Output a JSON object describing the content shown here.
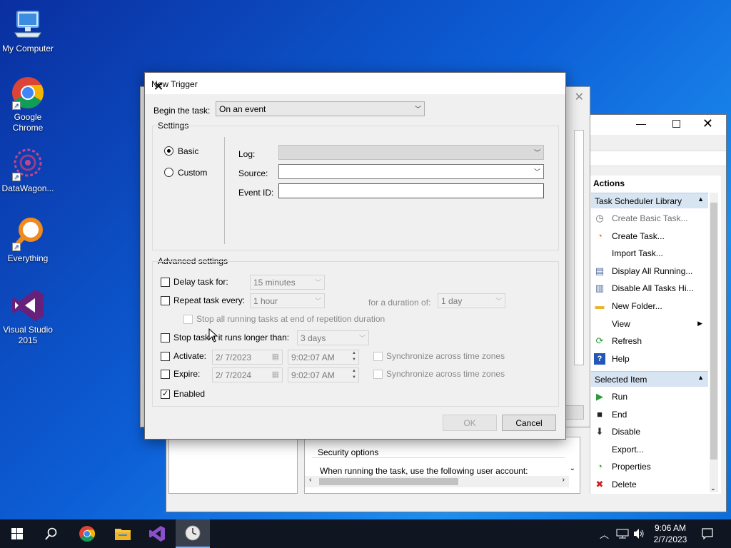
{
  "desktop": {
    "icons": [
      {
        "label": "My Computer"
      },
      {
        "label": "Google Chrome"
      },
      {
        "label": "DataWagon..."
      },
      {
        "label": "Everything"
      },
      {
        "label": "Visual Studio 2015"
      }
    ]
  },
  "task_scheduler": {
    "actions_title": "Actions",
    "library_section": "Task Scheduler Library",
    "library_items": [
      {
        "label": "Create Basic Task...",
        "icon": "create-basic-task-icon"
      },
      {
        "label": "Create Task...",
        "icon": "create-task-icon"
      },
      {
        "label": "Import Task...",
        "icon": ""
      },
      {
        "label": "Display All Running...",
        "icon": "display-running-icon"
      },
      {
        "label": "Disable All Tasks Hi...",
        "icon": "disable-history-icon"
      },
      {
        "label": "New Folder...",
        "icon": "folder-icon"
      },
      {
        "label": "View",
        "icon": ""
      },
      {
        "label": "Refresh",
        "icon": "refresh-icon"
      },
      {
        "label": "Help",
        "icon": "help-icon"
      }
    ],
    "selected_section": "Selected Item",
    "selected_items": [
      {
        "label": "Run",
        "icon": "run-icon"
      },
      {
        "label": "End",
        "icon": "end-icon"
      },
      {
        "label": "Disable",
        "icon": "disable-icon"
      },
      {
        "label": "Export...",
        "icon": ""
      },
      {
        "label": "Properties",
        "icon": "properties-icon"
      },
      {
        "label": "Delete",
        "icon": "delete-icon"
      }
    ],
    "security_options": "Security options",
    "security_text": "When running the task, use the following user account:"
  },
  "dialog": {
    "title": "New Trigger",
    "begin_label": "Begin the task:",
    "begin_value": "On an event",
    "settings_label": "Settings",
    "basic_label": "Basic",
    "custom_label": "Custom",
    "log_label": "Log:",
    "source_label": "Source:",
    "event_id_label": "Event ID:",
    "log_value": "",
    "source_value": "",
    "event_id_value": "",
    "advanced_label": "Advanced settings",
    "delay_label": "Delay task for:",
    "delay_value": "15 minutes",
    "repeat_label": "Repeat task every:",
    "repeat_value": "1 hour",
    "duration_label": "for a duration of:",
    "duration_value": "1 day",
    "stop_running_label": "Stop all running tasks at end of repetition duration",
    "stop_longer_label": "Stop task if it runs longer than:",
    "stop_longer_value": "3 days",
    "activate_label": "Activate:",
    "activate_date": "2/  7/2023",
    "activate_time": "9:02:07 AM",
    "expire_label": "Expire:",
    "expire_date": "2/  7/2024",
    "expire_time": "9:02:07 AM",
    "sync_label_1": "Synchronize across time zones",
    "sync_label_2": "Synchronize across time zones",
    "enabled_label": "Enabled",
    "ok_label": "OK",
    "cancel_label": "Cancel"
  },
  "taskbar": {
    "time": "9:06 AM",
    "date": "2/7/2023"
  }
}
